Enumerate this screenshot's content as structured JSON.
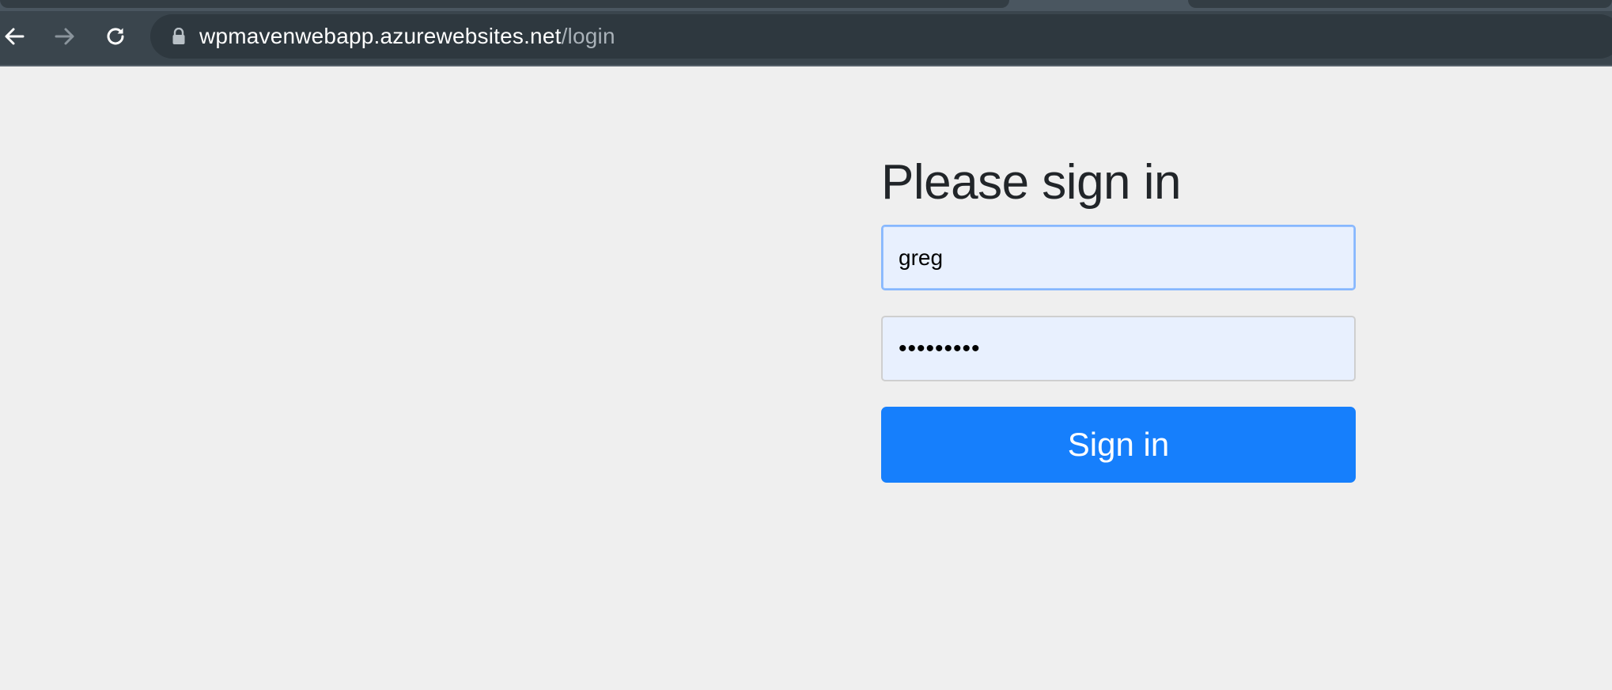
{
  "browser": {
    "url_host": "wpmavenwebapp.azurewebsites.net",
    "url_path": "/login",
    "icons": {
      "back": "back-arrow-icon",
      "forward": "forward-arrow-icon",
      "reload": "reload-icon",
      "lock": "lock-icon"
    }
  },
  "form": {
    "title": "Please sign in",
    "username_value": "greg",
    "password_value": "•••••••••",
    "submit_label": "Sign in"
  },
  "colors": {
    "page_background": "#efefef",
    "primary_button": "#167ffc",
    "input_fill": "#e8f0fe",
    "focus_border": "#86b7fe",
    "chrome_background": "#3a454d"
  }
}
